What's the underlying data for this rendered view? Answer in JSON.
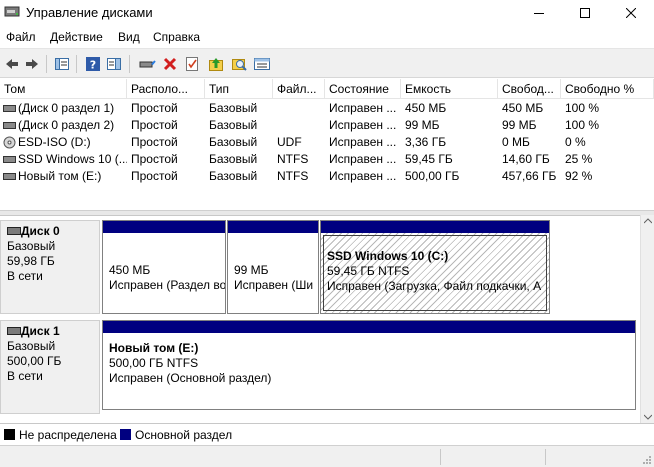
{
  "window": {
    "title": "Управление дисками"
  },
  "menu": [
    "Файл",
    "Действие",
    "Вид",
    "Справка"
  ],
  "toolbar": {
    "icons": [
      "back-arrow-icon",
      "forward-arrow-icon",
      "panel-icon",
      "help-icon",
      "panel2-icon",
      "connect-icon",
      "delete-icon",
      "properties-icon",
      "up-icon",
      "search-icon",
      "details-icon"
    ]
  },
  "volume_list": {
    "columns": [
      "Том",
      "Располо...",
      "Тип",
      "Файл...",
      "Состояние",
      "Емкость",
      "Свобод...",
      "Свободно %"
    ],
    "rows": [
      [
        "(Диск 0 раздел 1)",
        "Простой",
        "Базовый",
        "",
        "Исправен ...",
        "450 МБ",
        "450 МБ",
        "100 %"
      ],
      [
        "(Диск 0 раздел 2)",
        "Простой",
        "Базовый",
        "",
        "Исправен ...",
        "99 МБ",
        "99 МБ",
        "100 %"
      ],
      [
        "ESD-ISO (D:)",
        "Простой",
        "Базовый",
        "UDF",
        "Исправен ...",
        "3,36 ГБ",
        "0 МБ",
        "0 %"
      ],
      [
        "SSD Windows 10 (...",
        "Простой",
        "Базовый",
        "NTFS",
        "Исправен ...",
        "59,45 ГБ",
        "14,60 ГБ",
        "25 %"
      ],
      [
        "Новый том (E:)",
        "Простой",
        "Базовый",
        "NTFS",
        "Исправен ...",
        "500,00 ГБ",
        "457,66 ГБ",
        "92 %"
      ]
    ]
  },
  "disks": [
    {
      "name": "Диск 0",
      "type": "Базовый",
      "size": "59,98 ГБ",
      "status": "В сети",
      "partitions": [
        {
          "title": "",
          "size": "450 МБ",
          "status": "Исправен (Раздел во"
        },
        {
          "title": "",
          "size": "99 МБ",
          "status": "Исправен (Ши"
        },
        {
          "title": "SSD Windows 10  (C:)",
          "size": "59,45 ГБ NTFS",
          "status": "Исправен (Загрузка, Файл подкачки, А"
        }
      ]
    },
    {
      "name": "Диск 1",
      "type": "Базовый",
      "size": "500,00 ГБ",
      "status": "В сети",
      "partitions": [
        {
          "title": "Новый том  (E:)",
          "size": "500,00 ГБ NTFS",
          "status": "Исправен (Основной раздел)"
        }
      ]
    }
  ],
  "legend": [
    {
      "label": "Не распределена",
      "color": "#000000"
    },
    {
      "label": "Основной раздел",
      "color": "#000080"
    }
  ]
}
